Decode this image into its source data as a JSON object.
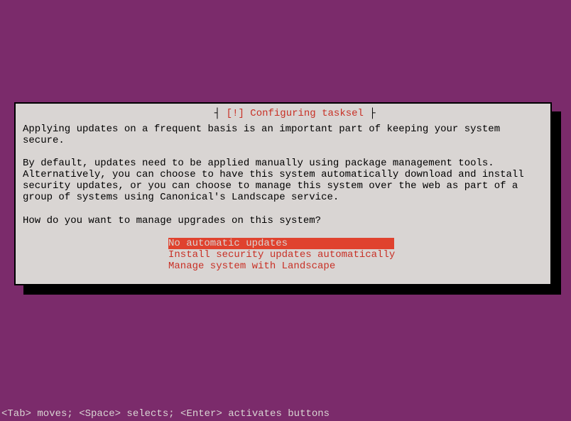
{
  "dialog": {
    "title_prefix": "[!]",
    "title": "Configuring tasksel",
    "paragraph1": "Applying updates on a frequent basis is an important part of keeping your system secure.",
    "paragraph2": "By default, updates need to be applied manually using package management tools. Alternatively, you can choose to have this system automatically download and install security updates, or you can choose to manage this system over the web as part of a group of systems using Canonical's Landscape service.",
    "question": "How do you want to manage upgrades on this system?",
    "options": [
      {
        "label": "No automatic updates",
        "selected": true
      },
      {
        "label": "Install security updates automatically",
        "selected": false
      },
      {
        "label": "Manage system with Landscape",
        "selected": false
      }
    ]
  },
  "footer": "<Tab> moves; <Space> selects; <Enter> activates buttons"
}
